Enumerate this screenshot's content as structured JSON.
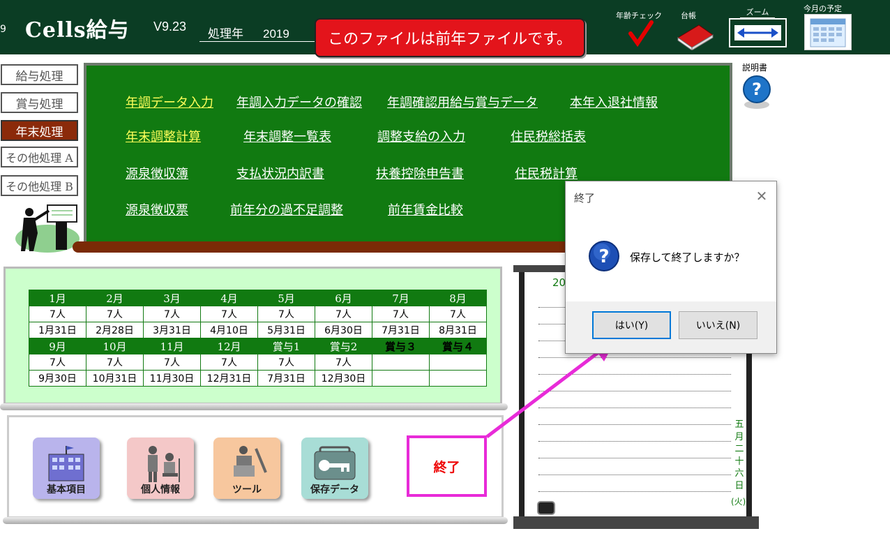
{
  "header": {
    "app_title": "Cells給与",
    "version": "V9.23",
    "year_label": "処理年",
    "year_value": "2019",
    "banner": "このファイルは前年ファイルです。",
    "age_check_label": "年齢チェック",
    "ledger_label": "台帳",
    "zoom_label": "ズーム",
    "schedule_label": "今月の予定",
    "manual_label": "説明書"
  },
  "nav": [
    "給与処理",
    "賞与処理",
    "年末処理",
    "その他処理 A",
    "その他処理 B"
  ],
  "menu": {
    "row1": [
      "年調データ入力",
      "年調入力データの確認",
      "年調確認用給与賞与データ",
      "本年入退社情報"
    ],
    "row2": [
      "年末調整計算",
      "年末調整一覧表",
      "調整支給の入力",
      "住民税総括表"
    ],
    "row3": [
      "源泉徴収簿",
      "支払状況内訳書",
      "扶養控除申告書",
      "住民税計算"
    ],
    "row4": [
      "源泉徴収票",
      "前年分の過不足調整",
      "前年賃金比較"
    ]
  },
  "calendar": {
    "row1_months": [
      "1月",
      "2月",
      "3月",
      "4月",
      "5月",
      "6月",
      "7月",
      "8月"
    ],
    "row1_counts": [
      "7人",
      "7人",
      "7人",
      "7人",
      "7人",
      "7人",
      "7人",
      "7人"
    ],
    "row1_dates": [
      "1月31日",
      "2月28日",
      "3月31日",
      "4月10日",
      "5月31日",
      "6月30日",
      "7月31日",
      "8月31日"
    ],
    "row2_months": [
      "9月",
      "10月",
      "11月",
      "12月",
      "賞与1",
      "賞与2",
      "賞与３",
      "賞与４"
    ],
    "row2_counts": [
      "7人",
      "7人",
      "7人",
      "7人",
      "7人",
      "7人",
      "",
      ""
    ],
    "row2_dates": [
      "9月30日",
      "10月31日",
      "11月30日",
      "12月31日",
      "7月31日",
      "12月30日",
      "",
      ""
    ]
  },
  "bottom": {
    "basic": "基本項目",
    "personal": "個人情報",
    "tools": "ツール",
    "saved": "保存データ",
    "exit": "終了"
  },
  "right_board": {
    "year_fragment": "20",
    "date_chars": [
      "五",
      "月",
      "二",
      "十",
      "六",
      "日"
    ],
    "weekday": "(火)"
  },
  "dialog": {
    "title": "終了",
    "message": "保存して終了しますか？",
    "yes": "はい(Y)",
    "no": "いいえ(N)"
  },
  "colors": {
    "header_bg": "#0b3d24",
    "board_green": "#117a11",
    "banner_red": "#e3141b",
    "highlight_magenta": "#e82bd8",
    "active_nav": "#8b2a0a"
  }
}
